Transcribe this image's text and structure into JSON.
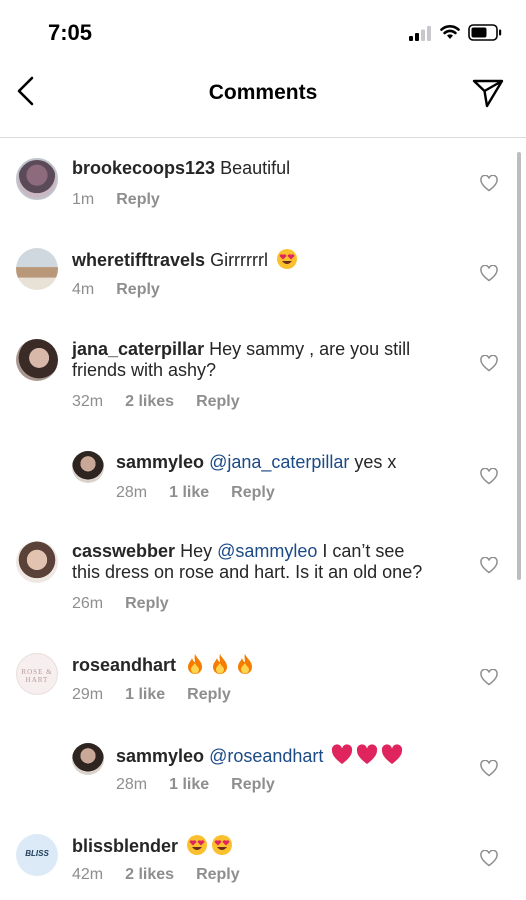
{
  "status_bar": {
    "time": "7:05"
  },
  "header": {
    "title": "Comments"
  },
  "comments": [
    {
      "username": "brookecoops123",
      "text": " Beautiful",
      "time": "1m",
      "reply": "Reply"
    },
    {
      "username": "wheretifftravels",
      "text": " Girrrrrrl",
      "emoji": "grinning-heart-eyes",
      "time": "4m",
      "reply": "Reply"
    },
    {
      "username": "jana_caterpillar",
      "text": " Hey sammy , are you still",
      "text_2": "friends with ashy?",
      "time": "32m",
      "likes": "2 likes",
      "reply": "Reply"
    },
    {
      "username": "sammyleo",
      "mention": " @jana_caterpillar",
      "text": " yes x",
      "time": "28m",
      "likes": "1 like",
      "reply": "Reply"
    },
    {
      "username": "casswebber",
      "text": " Hey ",
      "mention": "@sammyleo",
      "text_after": " I can’t see",
      "text_2": "this dress on rose and hart. Is it an old one?",
      "time": "26m",
      "reply": "Reply"
    },
    {
      "username": "roseandhart",
      "emoji": "fire",
      "time": "29m",
      "likes": "1 like",
      "reply": "Reply",
      "avatar_text": "ROSE & HART"
    },
    {
      "username": "sammyleo",
      "mention": " @roseandhart",
      "emoji": "red-heart",
      "time": "28m",
      "likes": "1 like",
      "reply": "Reply"
    },
    {
      "username": "blissblender",
      "emoji": "heart-eyes",
      "time": "42m",
      "likes": "2 likes",
      "reply": "Reply",
      "avatar_text": "BLISS"
    }
  ],
  "colors": {
    "mention": "#1c4a86",
    "meta": "#8e8e8e",
    "heart_emoji": "#e0245e"
  }
}
